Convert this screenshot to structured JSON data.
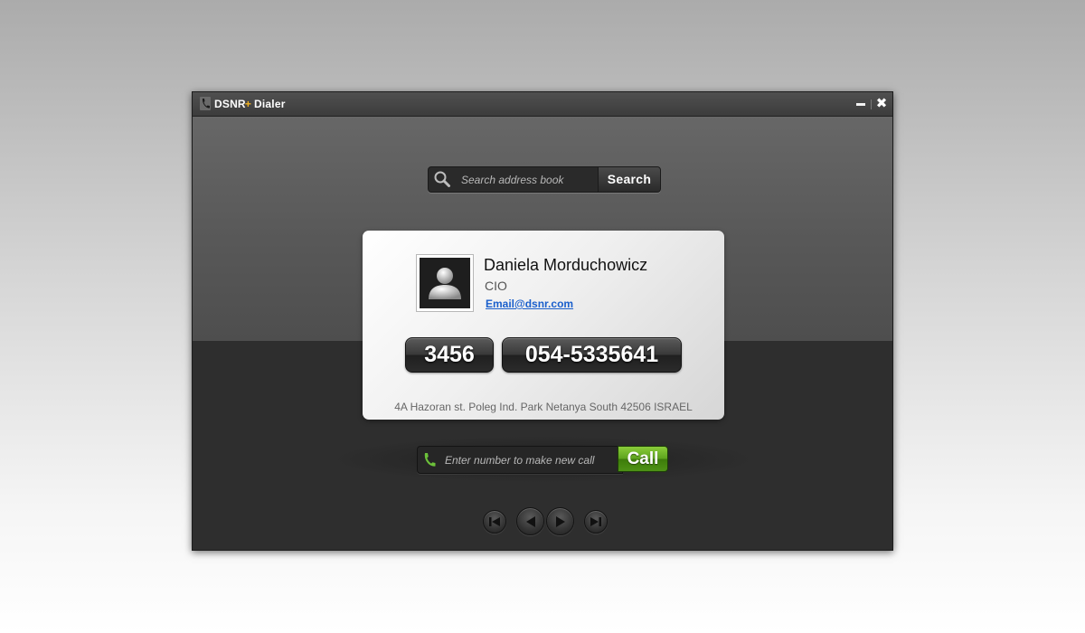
{
  "window": {
    "title_brand": "DSNR",
    "title_plus": "+",
    "title_app": "Dialer"
  },
  "search": {
    "placeholder": "Search address book",
    "button_label": "Search"
  },
  "contact": {
    "name": "Daniela Morduchowicz",
    "title": "CIO",
    "email": "Email@dsnr.com",
    "extension": "3456",
    "mobile": "054-5335641",
    "address": "4A Hazoran st. Poleg Ind. Park Netanya South 42506 ISRAEL"
  },
  "dialer": {
    "placeholder": "Enter number to make new call",
    "call_label": "Call"
  },
  "icons": {
    "app": "phone-icon",
    "search": "search-icon",
    "dial": "phone-icon",
    "first": "skip-first-icon",
    "prev": "previous-icon",
    "next": "next-icon",
    "last": "skip-last-icon"
  },
  "colors": {
    "accent_green": "#5ea41e",
    "link_blue": "#1a5fcc",
    "brand_plus": "#f0b020"
  }
}
